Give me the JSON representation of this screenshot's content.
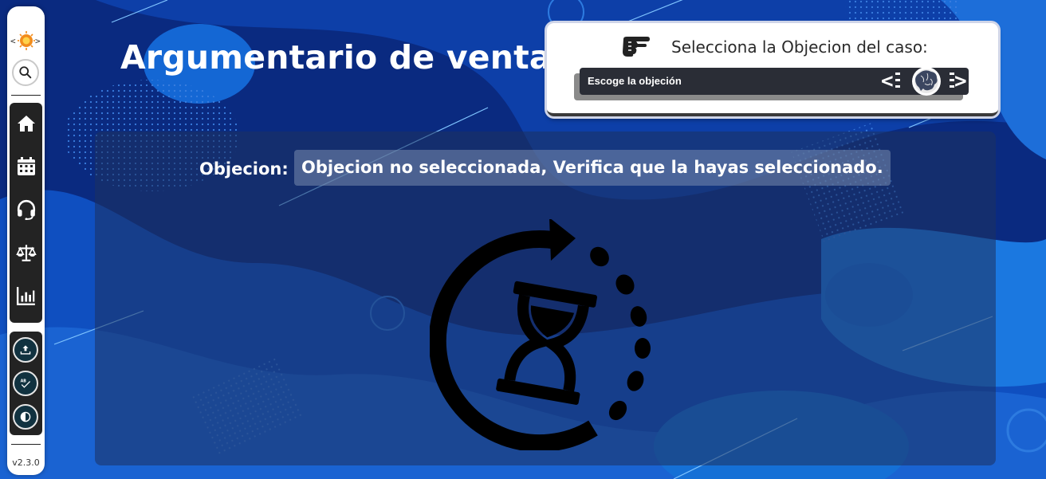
{
  "page": {
    "title": "Argumentario de ventas"
  },
  "sidebar": {
    "logo_icon": "brain-logo-icon",
    "search_icon": "search-icon",
    "nav_items": [
      {
        "id": "home",
        "icon": "home-icon"
      },
      {
        "id": "calendar",
        "icon": "calendar-icon"
      },
      {
        "id": "support",
        "icon": "headset-icon"
      },
      {
        "id": "legal",
        "icon": "balance-scale-icon"
      },
      {
        "id": "reports",
        "icon": "bar-chart-icon"
      }
    ],
    "tools": [
      {
        "id": "upload",
        "icon": "upload-icon"
      },
      {
        "id": "spellcheck",
        "icon": "spellcheck-icon"
      },
      {
        "id": "contrast",
        "icon": "contrast-icon"
      }
    ],
    "version": "v2.3.0"
  },
  "selector": {
    "title": "Selecciona la Objecion del caso:",
    "pointer_icon": "pointing-hand-icon",
    "dropdown_value": "Escoge la objeción",
    "dropdown_icon": "brain-code-icon"
  },
  "objection": {
    "label": "Objecion:",
    "value": "Objecion no seleccionada, Verifica que la hayas seleccionado."
  },
  "status_icon": "hourglass-refresh-icon",
  "colors": {
    "background": "#0a2f8c",
    "panel": "#1e325f",
    "card": "#ffffff",
    "dropdown": "#2a2d36"
  }
}
